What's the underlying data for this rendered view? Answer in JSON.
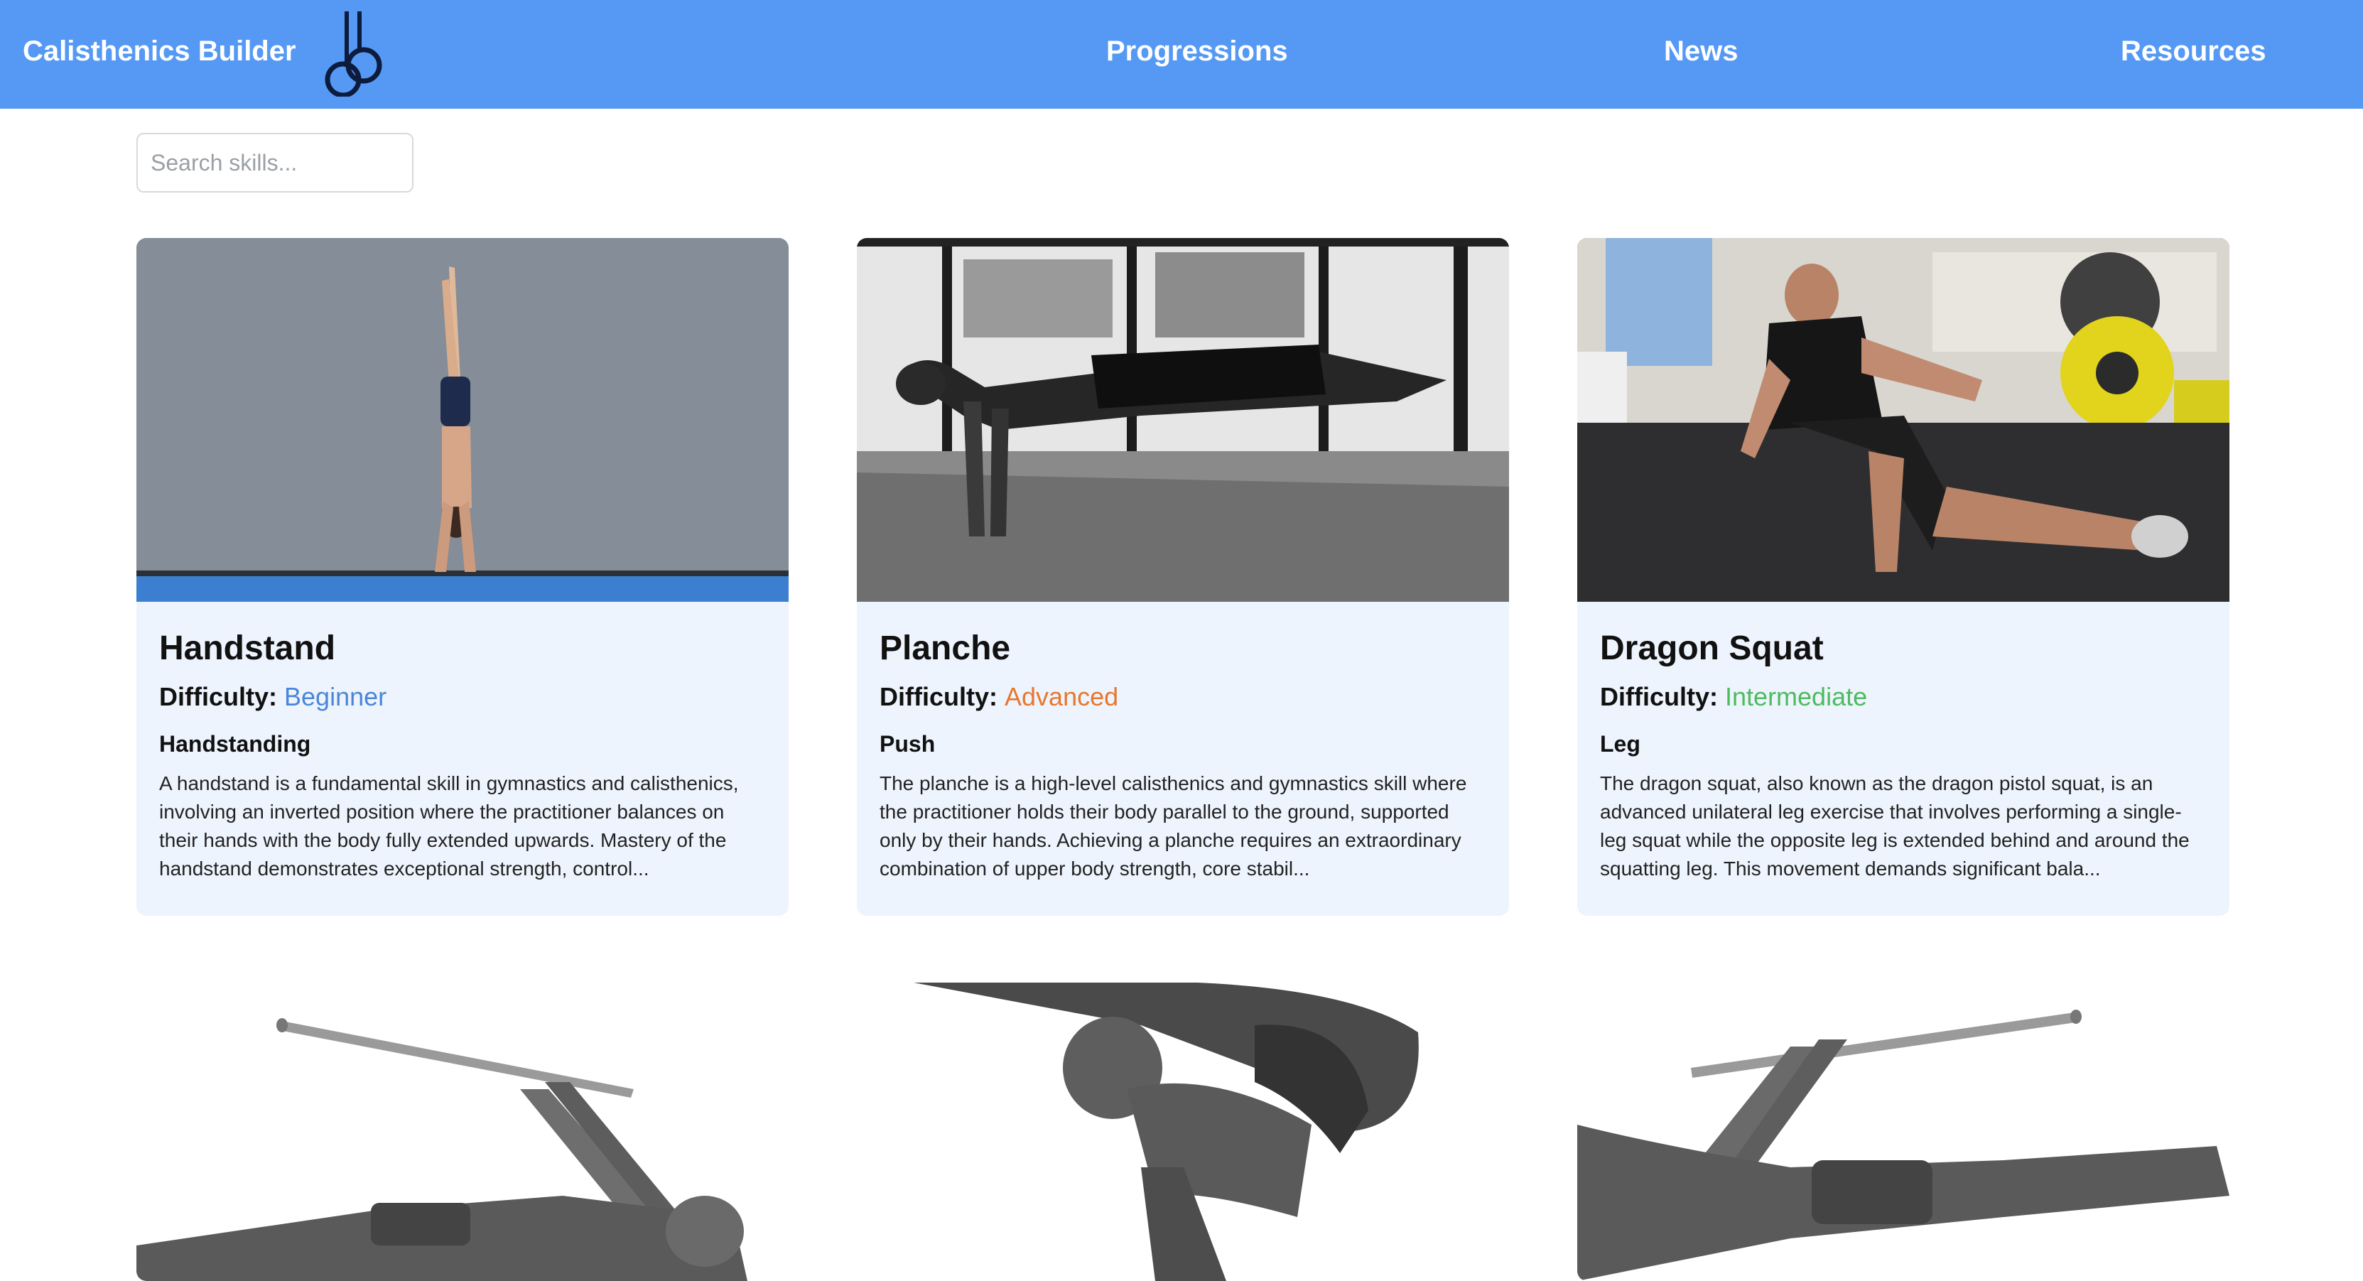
{
  "app": {
    "brand": "Calisthenics Builder",
    "logo_icon": "gymnastic-rings-icon"
  },
  "nav": {
    "progressions": "Progressions",
    "news": "News",
    "resources": "Resources"
  },
  "search": {
    "placeholder": "Search skills...",
    "value": ""
  },
  "difficulty_label": "Difficulty:",
  "colors": {
    "navbar": "#5599f5",
    "beginner": "#4a86d9",
    "advanced": "#e8772e",
    "intermediate": "#4dbb5f",
    "card_bg": "#eef4fd"
  },
  "cards": [
    {
      "title": "Handstand",
      "difficulty": "Beginner",
      "category": "Handstanding",
      "description": "A handstand is a fundamental skill in gymnastics and calisthenics, involving an inverted position where the practitioner balances on their hands with the body fully extended upwards. Mastery of the handstand demonstrates exceptional strength, control..."
    },
    {
      "title": "Planche",
      "difficulty": "Advanced",
      "category": "Push",
      "description": "The planche is a high-level calisthenics and gymnastics skill where the practitioner holds their body parallel to the ground, supported only by their hands. Achieving a planche requires an extraordinary combination of upper body strength, core stabil..."
    },
    {
      "title": "Dragon Squat",
      "difficulty": "Intermediate",
      "category": "Leg",
      "description": "The dragon squat, also known as the dragon pistol squat, is an advanced unilateral leg exercise that involves performing a single-leg squat while the opposite leg is extended behind and around the squatting leg. This movement demands significant bala..."
    }
  ]
}
